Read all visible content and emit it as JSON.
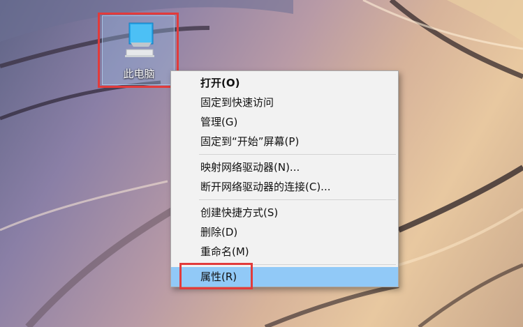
{
  "desktop": {
    "icon_label": "此电脑"
  },
  "context_menu": {
    "items": [
      {
        "label": "打开(O)"
      },
      {
        "label": "固定到快速访问"
      },
      {
        "label": "管理(G)"
      },
      {
        "label": "固定到“开始”屏幕(P)"
      },
      {
        "label": "映射网络驱动器(N)..."
      },
      {
        "label": "断开网络驱动器的连接(C)..."
      },
      {
        "label": "创建快捷方式(S)"
      },
      {
        "label": "删除(D)"
      },
      {
        "label": "重命名(M)"
      },
      {
        "label": "属性(R)"
      }
    ]
  },
  "colors": {
    "highlight_border": "#e23b3b",
    "selected_item": "#91c9f7",
    "menu_background": "#f2f2f2"
  },
  "icons": [
    "monitor-icon"
  ]
}
